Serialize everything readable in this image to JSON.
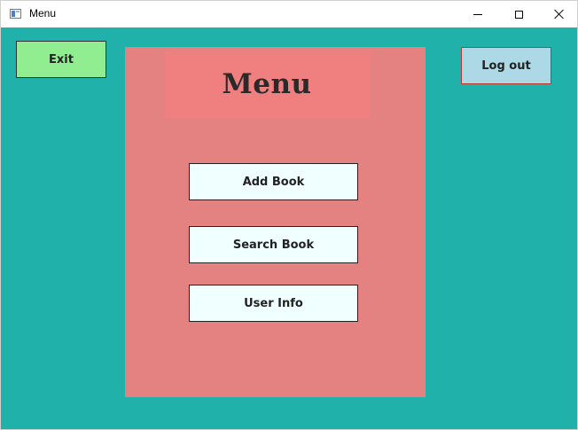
{
  "window": {
    "title": "Menu",
    "icon": "app-window-icon",
    "controls": [
      "minimize-icon",
      "maximize-icon",
      "close-icon"
    ]
  },
  "toolbar": {
    "exit_label": "Exit",
    "logout_label": "Log out"
  },
  "menu": {
    "title": "Menu",
    "buttons": [
      {
        "label": "Add Book"
      },
      {
        "label": "Search Book"
      },
      {
        "label": "User Info"
      }
    ]
  },
  "colors": {
    "background": "#20b2aa",
    "panel": "#e48282",
    "title_box": "#f08080",
    "exit_button": "#90ee90",
    "logout_button": "#add8e6",
    "logout_border": "#c0392b",
    "menu_button": "#f0ffff"
  }
}
